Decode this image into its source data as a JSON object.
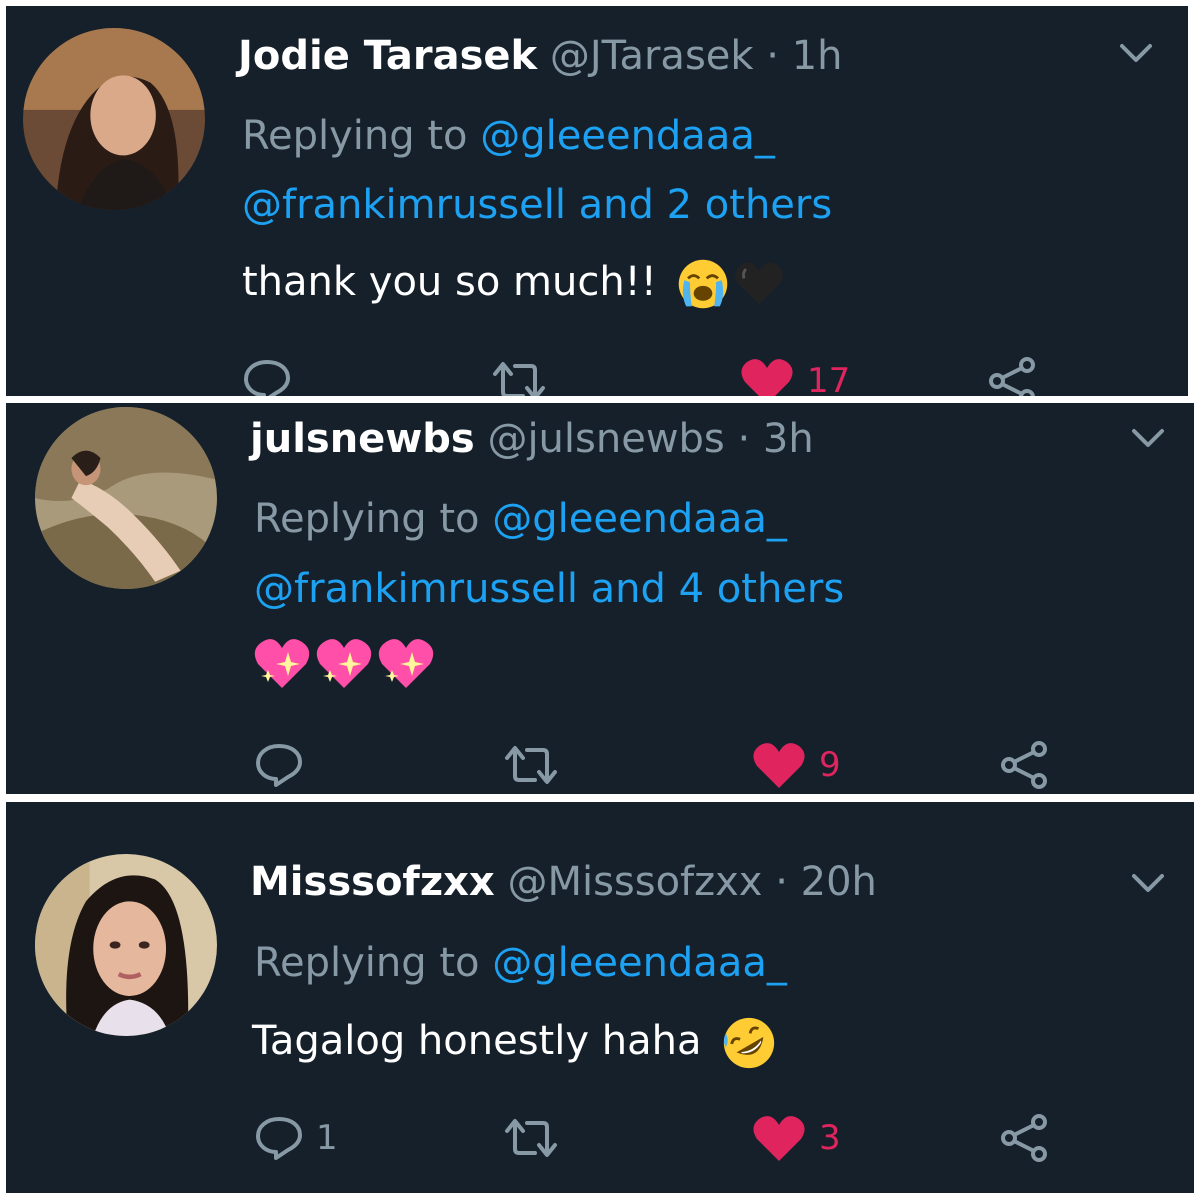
{
  "tweets": [
    {
      "name": "Jodie Tarasek",
      "handle": "@JTarasek",
      "separator": "·",
      "time": "1h",
      "replying_prefix": "Replying to",
      "mention_primary": "@gleeendaaa_",
      "mention_secondary": "@frankimrussell and 2 others",
      "text": "thank you so much!!",
      "emojis": [
        "loudly-crying-face",
        "black-heart"
      ],
      "replies": "",
      "likes": "17",
      "liked": true
    },
    {
      "name": "julsnewbs",
      "handle": "@julsnewbs",
      "separator": "·",
      "time": "3h",
      "replying_prefix": "Replying to",
      "mention_primary": "@gleeendaaa_",
      "mention_secondary": "@frankimrussell and 4 others",
      "text": "",
      "emojis": [
        "sparkling-heart",
        "sparkling-heart",
        "sparkling-heart"
      ],
      "replies": "",
      "likes": "9",
      "liked": true
    },
    {
      "name": "Misssofzxx",
      "handle": "@Misssofzxx",
      "separator": "·",
      "time": "20h",
      "replying_prefix": "Replying to",
      "mention_primary": "@gleeendaaa_",
      "mention_secondary": "",
      "text": "Tagalog honestly haha",
      "emojis": [
        "rolling-on-floor-laughing"
      ],
      "replies": "1",
      "likes": "3",
      "liked": true
    }
  ],
  "colors": {
    "background": "#15202b",
    "name": "#ffffff",
    "muted": "#8899a6",
    "link": "#1da1f2",
    "like": "#e0245e"
  }
}
